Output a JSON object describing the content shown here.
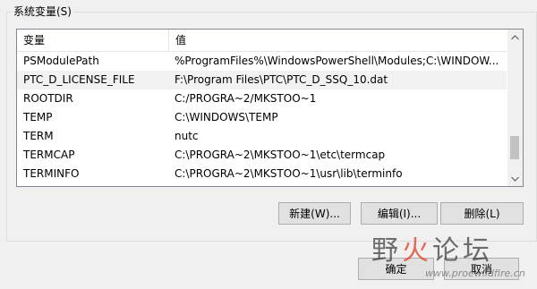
{
  "group": {
    "label": "系统变量(S)"
  },
  "list": {
    "headers": {
      "variable": "变量",
      "value": "值"
    },
    "rows": [
      {
        "variable": "PSModulePath",
        "value": "%ProgramFiles%\\WindowsPowerShell\\Modules;C:\\WINDOW..."
      },
      {
        "variable": "PTC_D_LICENSE_FILE",
        "value": "F:\\Program Files\\PTC\\PTC_D_SSQ_10.dat"
      },
      {
        "variable": "ROOTDIR",
        "value": "C:/PROGRA~2/MKSTOO~1"
      },
      {
        "variable": "TEMP",
        "value": "C:\\WINDOWS\\TEMP"
      },
      {
        "variable": "TERM",
        "value": "nutc"
      },
      {
        "variable": "TERMCAP",
        "value": "C:\\PROGRA~2\\MKSTOO~1\\etc\\termcap"
      },
      {
        "variable": "TERMINFO",
        "value": "C:\\PROGRA~2\\MKSTOO~1\\usr\\lib\\terminfo"
      }
    ],
    "highlighted_row": 1
  },
  "scrollbar": {
    "up_icon": "chevron-up-icon",
    "down_icon": "chevron-down-icon"
  },
  "buttons": {
    "new": "新建(W)...",
    "edit": "编辑(I)...",
    "delete": "删除(L)",
    "ok": "确定",
    "cancel": "取消"
  },
  "watermark": {
    "text_part1": "野",
    "text_part2": "火",
    "text_part3": "论坛",
    "url": "www.proewildfire.cn"
  },
  "colors": {
    "window_bg": "#f0f0f0",
    "list_bg": "#ffffff",
    "row_highlight": "#f2f2f2",
    "button_bg": "#e1e1e1",
    "button_border": "#adadad",
    "scroll_thumb": "#c2c2c2"
  }
}
